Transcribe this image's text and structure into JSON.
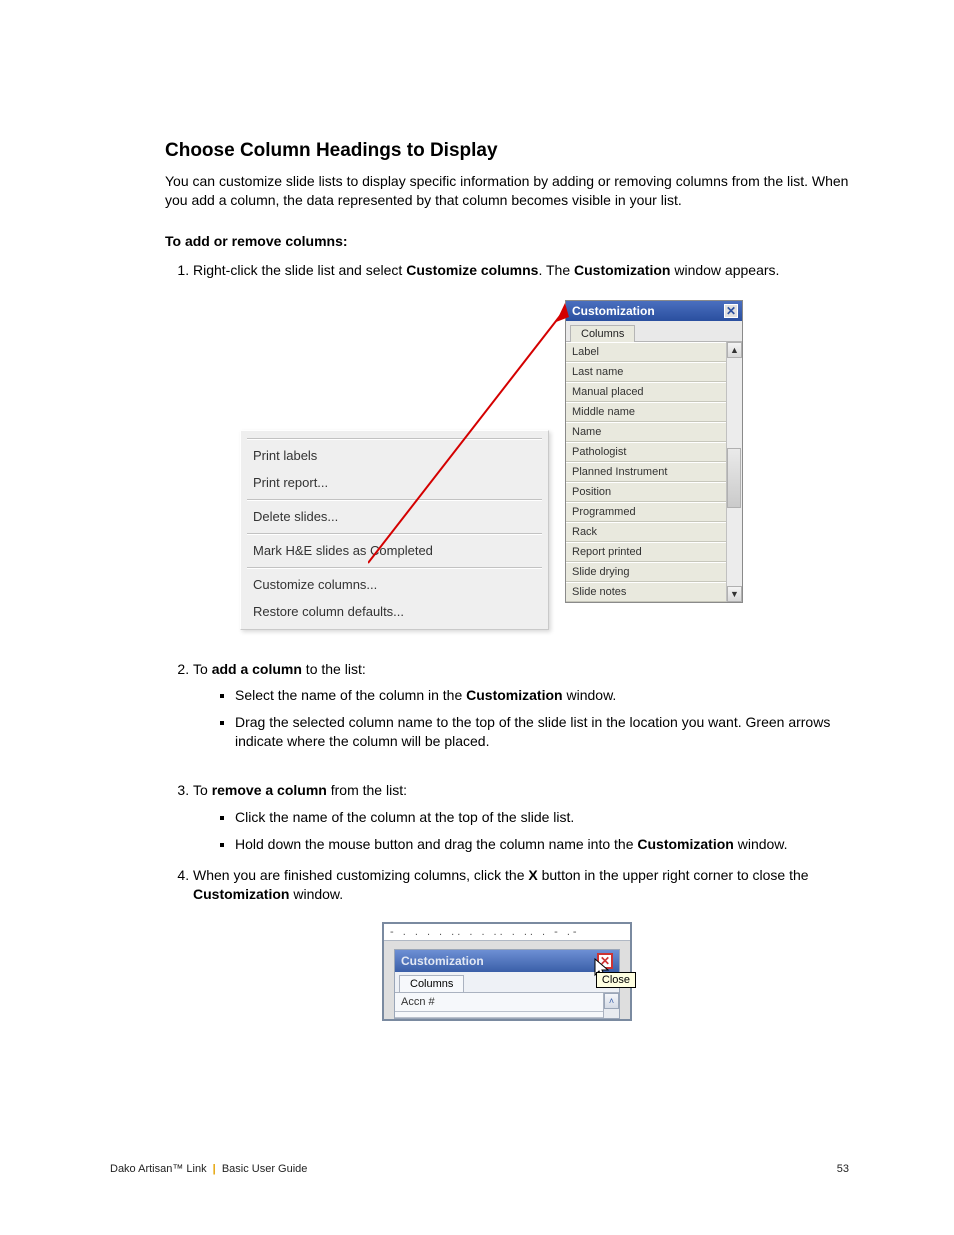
{
  "heading": "Choose Column Headings to Display",
  "intro": "You can customize slide lists to display specific information by adding or removing columns from the list. When you add a column, the data represented by that column becomes visible in your list.",
  "procedure_heading": "To add or remove columns:",
  "step1": {
    "pre": "Right-click the slide list and select ",
    "b1": "Customize columns",
    "mid": ". The ",
    "b2": "Customization",
    "post": " window appears."
  },
  "context_menu": {
    "items_top": [
      "Print labels",
      "Print report..."
    ],
    "items_mid": [
      "Delete slides..."
    ],
    "items_mid2": [
      "Mark H&E slides as Completed"
    ],
    "items_bot": [
      "Customize columns...",
      "Restore column defaults..."
    ]
  },
  "customization_panel": {
    "title": "Customization",
    "tab": "Columns",
    "columns": [
      "Label",
      "Last name",
      "Manual placed",
      "Middle name",
      "Name",
      "Pathologist",
      "Planned Instrument",
      "Position",
      "Programmed",
      "Rack",
      "Report printed",
      "Slide drying",
      "Slide notes"
    ]
  },
  "step2": {
    "lead_pre": "To ",
    "lead_b": "add a column",
    "lead_post": " to the list:",
    "bullets": [
      {
        "pre": "Select the name of the column in the ",
        "b": "Customization",
        "post": " window."
      },
      {
        "text": "Drag the selected column name to the top of the slide list in the location you want. Green arrows indicate where the column will be placed."
      }
    ]
  },
  "step3": {
    "lead_pre": "To ",
    "lead_b": "remove a column",
    "lead_post": " from the list:",
    "bullets": [
      {
        "text": "Click the name of the column at the top of the slide list."
      },
      {
        "pre": "Hold down the mouse button and drag the column name into the ",
        "b": "Customization",
        "post": " window."
      }
    ]
  },
  "step4": {
    "pre": "When you are finished customizing columns, click the ",
    "b1": "X",
    "mid": " button in the upper right corner to close the ",
    "b2": "Customization",
    "post": " window."
  },
  "panel2": {
    "title": "Customization",
    "tooltip": "Close",
    "tab": "Columns",
    "row1": "Accn #"
  },
  "footer": {
    "product": "Dako Artisan™ Link",
    "guide": "Basic User Guide",
    "page": "53"
  }
}
